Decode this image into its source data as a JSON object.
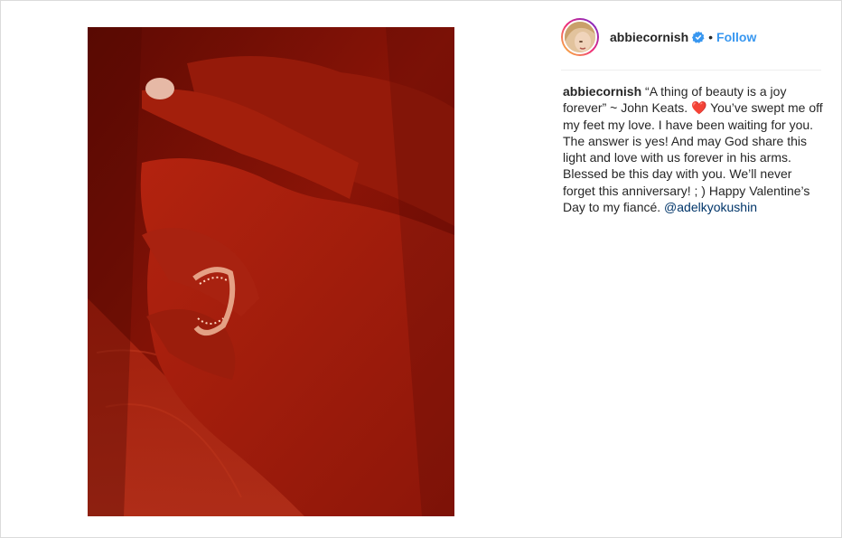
{
  "post": {
    "username": "abbiecornish",
    "follow_label": "Follow",
    "separator": "•",
    "caption_part1": " “A thing of beauty is a joy forever” ~ John Keats. ",
    "caption_emoji": "❤️",
    "caption_part2": " You’ve swept me off my feet my love. I have been waiting for you. The answer is yes! And may God share this light and love with us forever in his arms. Blessed be this day with you. We’ll never forget this anniversary! ; ) Happy Valentine’s Day to my fiancé. ",
    "mention": "@adelkyokushin"
  },
  "colors": {
    "follow": "#3897f0",
    "mention": "#003569",
    "verified": "#3897f0",
    "photo_tint": "#7a0e05"
  },
  "icons": {
    "verified": "verified-badge-icon"
  }
}
